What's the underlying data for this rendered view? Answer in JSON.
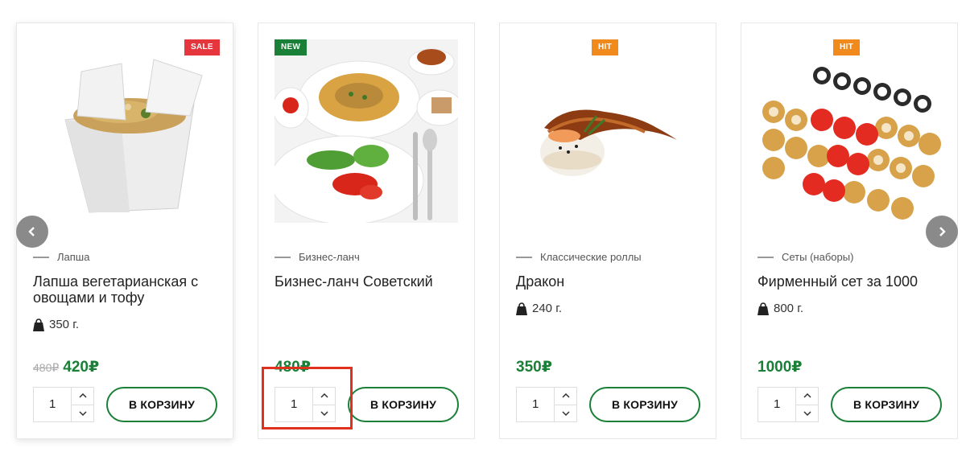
{
  "colors": {
    "accent_green": "#1a7f37",
    "sale_badge": "#e5363d",
    "new_badge": "#1a7f37",
    "hit_badge": "#f08a1c",
    "highlight_box": "#e0301e"
  },
  "carousel": {
    "prev_icon": "chevron-left-icon",
    "next_icon": "chevron-right-icon"
  },
  "products": [
    {
      "badge": "SALE",
      "image": "noodle-box-image",
      "category": "Лапша",
      "title": "Лапша вегетарианская с овощами и тофу",
      "weight": "350 г.",
      "old_price": "480₽",
      "price": "420₽",
      "qty": "1",
      "cart_label": "В КОРЗИНУ"
    },
    {
      "badge": "NEW",
      "image": "business-lunch-image",
      "category": "Бизнес-ланч",
      "title": "Бизнес-ланч Советский",
      "weight": "",
      "old_price": "",
      "price": "480₽",
      "qty": "1",
      "cart_label": "В КОРЗИНУ"
    },
    {
      "badge": "HIT",
      "image": "dragon-roll-image",
      "category": "Классические роллы",
      "title": "Дракон",
      "weight": "240 г.",
      "old_price": "",
      "price": "350₽",
      "qty": "1",
      "cart_label": "В КОРЗИНУ"
    },
    {
      "badge": "HIT",
      "image": "sushi-set-image",
      "category": "Сеты (наборы)",
      "title": "Фирменный сет за 1000",
      "weight": "800 г.",
      "old_price": "",
      "price": "1000₽",
      "qty": "1",
      "cart_label": "В КОРЗИНУ"
    }
  ]
}
